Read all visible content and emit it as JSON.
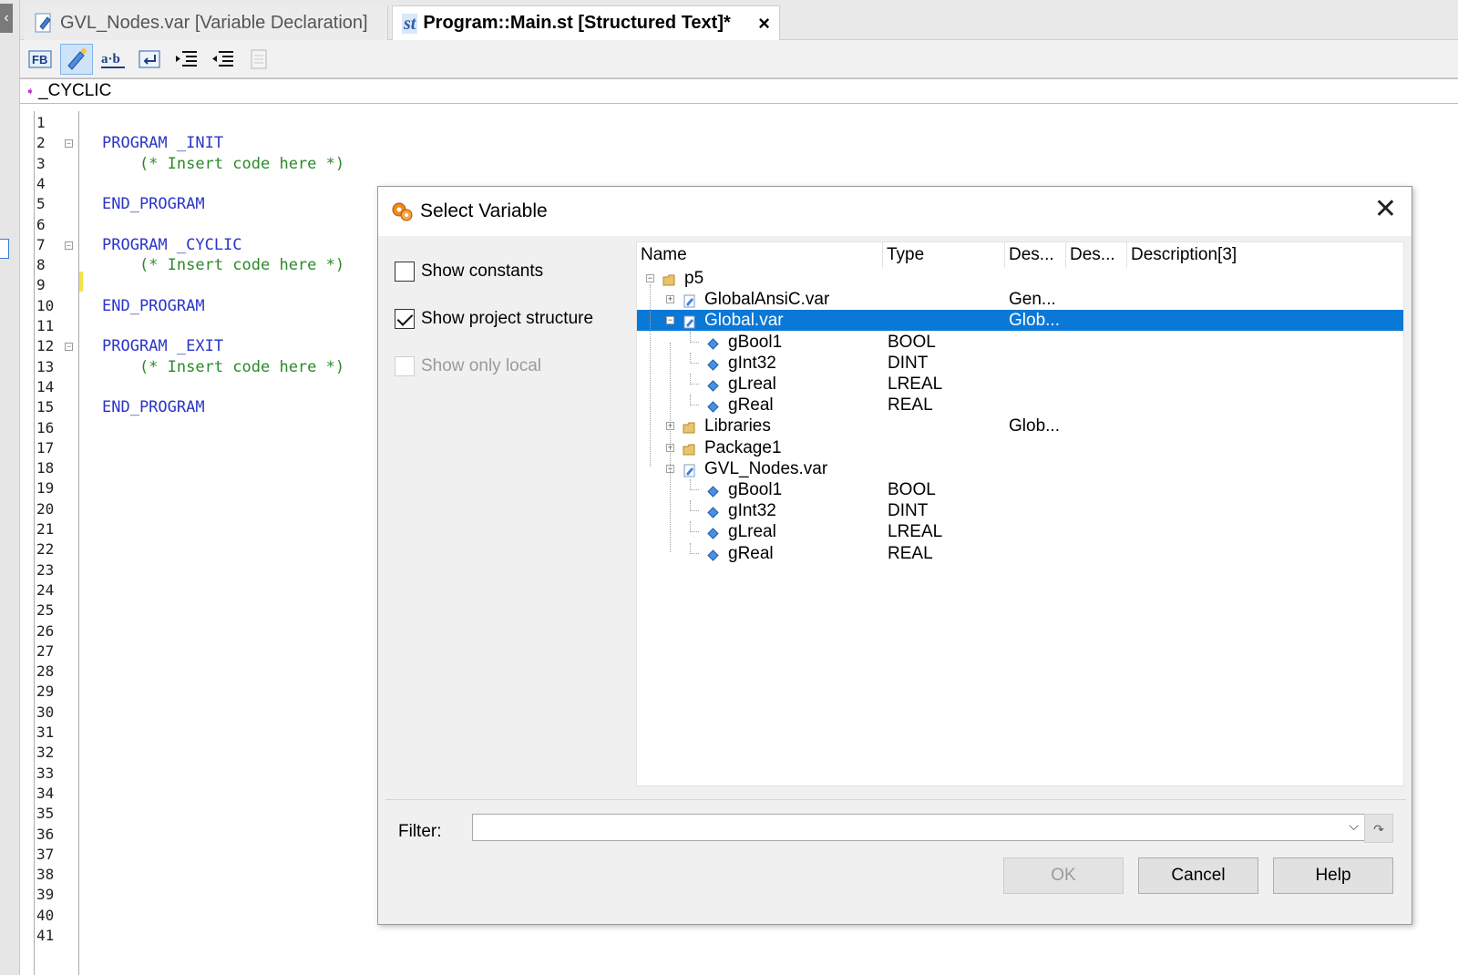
{
  "tabs": [
    {
      "label": "GVL_Nodes.var [Variable Declaration]",
      "active": false
    },
    {
      "label": "Program::Main.st [Structured Text]*",
      "active": true,
      "close": "×"
    }
  ],
  "toolbar": {
    "icons": [
      "fb-icon",
      "pencil-diamond-icon",
      "ab-rename-icon",
      "return-icon",
      "indent-icon",
      "outdent-icon",
      "page-icon"
    ],
    "fb_text": "FB",
    "ab_text": "a·b"
  },
  "breadcrumb": {
    "label": "_CYCLIC"
  },
  "editor": {
    "line_numbers": [
      "1",
      "2",
      "3",
      "4",
      "5",
      "6",
      "7",
      "8",
      "9",
      "10",
      "11",
      "12",
      "13",
      "14",
      "15",
      "16",
      "17",
      "18",
      "19",
      "20",
      "21",
      "22",
      "23",
      "24",
      "25",
      "26",
      "27",
      "28",
      "29",
      "30",
      "31",
      "32",
      "33",
      "34",
      "35",
      "36",
      "37",
      "38",
      "39",
      "40",
      "41"
    ],
    "code": [
      {
        "line": 2,
        "text": "PROGRAM _INIT",
        "kind": "kw",
        "fold": true
      },
      {
        "line": 3,
        "text": "    (* Insert code here *)",
        "kind": "cm"
      },
      {
        "line": 5,
        "text": "END_PROGRAM",
        "kind": "kw"
      },
      {
        "line": 7,
        "text": "PROGRAM _CYCLIC",
        "kind": "kw",
        "fold": true
      },
      {
        "line": 8,
        "text": "    (* Insert code here *)",
        "kind": "cm"
      },
      {
        "line": 10,
        "text": "END_PROGRAM",
        "kind": "kw"
      },
      {
        "line": 12,
        "text": "PROGRAM _EXIT",
        "kind": "kw",
        "fold": true
      },
      {
        "line": 13,
        "text": "    (* Insert code here *)",
        "kind": "cm"
      },
      {
        "line": 15,
        "text": "END_PROGRAM",
        "kind": "kw"
      }
    ]
  },
  "dialog": {
    "title": "Select Variable",
    "close": "✕",
    "options": {
      "show_constants": {
        "label": "Show constants",
        "checked": false,
        "enabled": true
      },
      "show_project_structure": {
        "label": "Show project structure",
        "checked": true,
        "enabled": true
      },
      "show_only_local": {
        "label": "Show only local",
        "checked": false,
        "enabled": false
      }
    },
    "columns": [
      "Name",
      "Type",
      "Des...",
      "Des...",
      "Description[3]"
    ],
    "tree": [
      {
        "name": "p5",
        "type": "",
        "desc": "",
        "level": 0,
        "icon": "folder-open",
        "expander": "⊟"
      },
      {
        "name": "GlobalAnsiC.var",
        "type": "",
        "desc": "Gen...",
        "level": 1,
        "icon": "var-file",
        "expander": "+"
      },
      {
        "name": "Global.var",
        "type": "",
        "desc": "Glob...",
        "level": 1,
        "icon": "var-file",
        "expander": "−",
        "selected": true
      },
      {
        "name": "gBool1",
        "type": "BOOL",
        "desc": "",
        "level": 2,
        "icon": "var-diamond"
      },
      {
        "name": "gInt32",
        "type": "DINT",
        "desc": "",
        "level": 2,
        "icon": "var-diamond"
      },
      {
        "name": "gLreal",
        "type": "LREAL",
        "desc": "",
        "level": 2,
        "icon": "var-diamond"
      },
      {
        "name": "gReal",
        "type": "REAL",
        "desc": "",
        "level": 2,
        "icon": "var-diamond"
      },
      {
        "name": "Libraries",
        "type": "",
        "desc": "Glob...",
        "level": 1,
        "icon": "folder",
        "expander": "+"
      },
      {
        "name": "Package1",
        "type": "",
        "desc": "",
        "level": 1,
        "icon": "folder",
        "expander": "+"
      },
      {
        "name": "GVL_Nodes.var",
        "type": "",
        "desc": "",
        "level": 1,
        "icon": "var-file",
        "expander": "−"
      },
      {
        "name": "gBool1",
        "type": "BOOL",
        "desc": "",
        "level": 2,
        "icon": "var-diamond"
      },
      {
        "name": "gInt32",
        "type": "DINT",
        "desc": "",
        "level": 2,
        "icon": "var-diamond"
      },
      {
        "name": "gLreal",
        "type": "LREAL",
        "desc": "",
        "level": 2,
        "icon": "var-diamond"
      },
      {
        "name": "gReal",
        "type": "REAL",
        "desc": "",
        "level": 2,
        "icon": "var-diamond"
      }
    ],
    "filter": {
      "label": "Filter:",
      "value": "",
      "dropdown": "⌵"
    },
    "buttons": {
      "ok": "OK",
      "cancel": "Cancel",
      "help": "Help"
    }
  },
  "colors": {
    "selection": "#0a78d7",
    "keyword": "#2b34c8",
    "comment": "#2a8a2a"
  }
}
